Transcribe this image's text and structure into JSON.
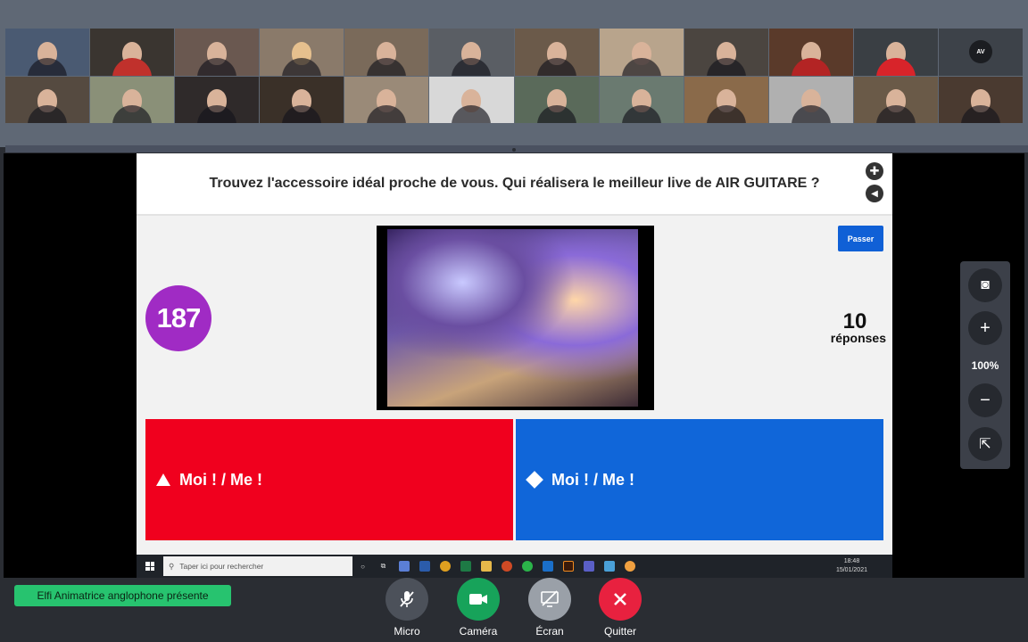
{
  "participants": {
    "avatar_initials": "AV"
  },
  "slide": {
    "question": "Trouvez l'accessoire idéal proche de vous. Qui réalisera le meilleur live de AIR GUITARE ?",
    "timer": "187",
    "skip_label": "Passer",
    "answers_count": "10",
    "answers_label": "réponses",
    "answer_1": "Moi ! / Me !",
    "answer_2": "Moi ! / Me !",
    "answer_1_color": "#f0001e",
    "answer_2_color": "#1066d9",
    "timer_color": "#a02bc4"
  },
  "taskbar": {
    "search_placeholder": "Taper ici pour rechercher",
    "time": "18:48",
    "date": "15/01/2021"
  },
  "zoom": {
    "level": "100%"
  },
  "controls": {
    "presenter_badge": "Elfi Animatrice anglophone présente",
    "micro": "Micro",
    "camera": "Caméra",
    "screen": "Écran",
    "quit": "Quitter"
  }
}
